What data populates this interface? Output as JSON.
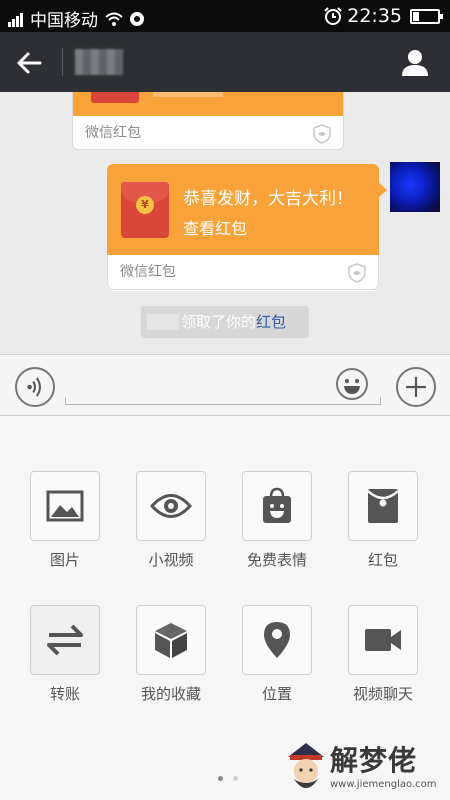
{
  "status_bar": {
    "carrier": "中国移动",
    "time": "22:35",
    "battery_level": 0.25
  },
  "header": {
    "back_icon": "arrow-left-icon",
    "profile_icon": "person-icon",
    "chat_title": ""
  },
  "chat": {
    "messages": [
      {
        "type": "red-packet",
        "footer": "微信红包",
        "partial": true
      },
      {
        "type": "red-packet",
        "greeting": "恭喜发财，大吉大利！",
        "action": "查看红包",
        "footer": "微信红包",
        "envelope_symbol": "¥"
      }
    ],
    "system_message": {
      "text": "领取了你的",
      "link": "红包"
    }
  },
  "input_bar": {
    "value": "",
    "placeholder": ""
  },
  "tools": [
    {
      "label": "图片",
      "icon": "image-icon"
    },
    {
      "label": "小视频",
      "icon": "eye-icon"
    },
    {
      "label": "免费表情",
      "icon": "sticker-bag-icon"
    },
    {
      "label": "红包",
      "icon": "red-packet-icon"
    },
    {
      "label": "转账",
      "icon": "transfer-icon"
    },
    {
      "label": "我的收藏",
      "icon": "cube-icon"
    },
    {
      "label": "位置",
      "icon": "location-pin-icon"
    },
    {
      "label": "视频聊天",
      "icon": "video-camera-icon"
    }
  ],
  "pager": {
    "current_page": 1,
    "total_pages": 2
  },
  "watermark": {
    "text": "解梦佬",
    "url": "www.jiemenglao.com"
  },
  "colors": {
    "accent_orange": "#f8a23a",
    "envelope_red": "#d9473a",
    "header_bg": "#2d2f34"
  }
}
